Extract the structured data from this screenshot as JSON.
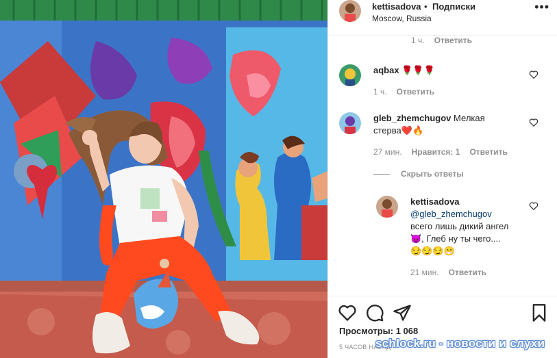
{
  "post": {
    "username": "kettisadova",
    "dot": "•",
    "follow_label": "Подписки",
    "location": "Moscow, Russia",
    "more_icon": "more-options-icon"
  },
  "top_meta": {
    "time": "1 ч.",
    "reply": "Ответить"
  },
  "comments": [
    {
      "username": "aqbax",
      "text": "🌹🌹🌹",
      "time": "1 ч.",
      "reply": "Ответить"
    },
    {
      "username": "gleb_zhemchugov",
      "text_line1": "Мелкая",
      "text_line2": "стерва❤️🔥",
      "time": "27 мин.",
      "likes": "Нравится: 1",
      "reply": "Ответить"
    }
  ],
  "hide_replies": "Скрыть ответы",
  "reply": {
    "username": "kettisadova",
    "mention": "@gleb_zhemchugov",
    "line1": "всего лишь дикий ангел",
    "line2": "😈, Глеб ну ты чего....",
    "line3": "😏😏😏😁",
    "time": "21 мин.",
    "reply": "Ответить"
  },
  "actions": {
    "like_icon": "heart-icon",
    "comment_icon": "comment-icon",
    "share_icon": "share-icon",
    "save_icon": "bookmark-icon"
  },
  "views": "Просмотры: 1 068",
  "timestamp": "5 ЧАСОВ НАЗАД",
  "watermark": "schlock.ru - новости и слухи",
  "colors": {
    "text": "#262626",
    "muted": "#8e8e8e",
    "link": "#00376b",
    "border": "#efefef"
  }
}
